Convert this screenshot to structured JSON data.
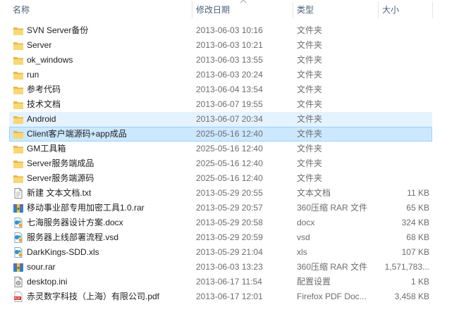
{
  "columns": {
    "name": "名称",
    "date": "修改日期",
    "type": "类型",
    "size": "大小"
  },
  "rows": [
    {
      "name": "SVN Server备份",
      "date": "2013-06-03 10:16",
      "type": "文件夹",
      "size": "",
      "icon": "folder-icon",
      "state": ""
    },
    {
      "name": "Server",
      "date": "2013-06-03 10:21",
      "type": "文件夹",
      "size": "",
      "icon": "folder-icon",
      "state": ""
    },
    {
      "name": "ok_windows",
      "date": "2013-06-03 13:55",
      "type": "文件夹",
      "size": "",
      "icon": "folder-icon",
      "state": ""
    },
    {
      "name": "run",
      "date": "2013-06-03 20:24",
      "type": "文件夹",
      "size": "",
      "icon": "folder-icon",
      "state": ""
    },
    {
      "name": "参考代码",
      "date": "2013-06-04 13:54",
      "type": "文件夹",
      "size": "",
      "icon": "folder-icon",
      "state": ""
    },
    {
      "name": "技术文档",
      "date": "2013-06-07 19:55",
      "type": "文件夹",
      "size": "",
      "icon": "folder-icon",
      "state": ""
    },
    {
      "name": "Android",
      "date": "2013-06-07 20:34",
      "type": "文件夹",
      "size": "",
      "icon": "folder-icon",
      "state": "hover"
    },
    {
      "name": "Client客户端源码+app成品",
      "date": "2025-05-16 12:40",
      "type": "文件夹",
      "size": "",
      "icon": "folder-icon",
      "state": "selected"
    },
    {
      "name": "GM工具箱",
      "date": "2025-05-16 12:40",
      "type": "文件夹",
      "size": "",
      "icon": "folder-icon",
      "state": ""
    },
    {
      "name": "Server服务端成品",
      "date": "2025-05-16 12:40",
      "type": "文件夹",
      "size": "",
      "icon": "folder-icon",
      "state": ""
    },
    {
      "name": "Server服务端源码",
      "date": "2025-05-16 12:40",
      "type": "文件夹",
      "size": "",
      "icon": "folder-icon",
      "state": ""
    },
    {
      "name": "新建 文本文档.txt",
      "date": "2013-05-29 20:55",
      "type": "文本文档",
      "size": "11 KB",
      "icon": "text-file-icon",
      "state": ""
    },
    {
      "name": "移动事业部专用加密工具1.0.rar",
      "date": "2013-05-29 20:57",
      "type": "360压缩 RAR 文件",
      "size": "65 KB",
      "icon": "rar-archive-icon",
      "state": ""
    },
    {
      "name": "七海服务器设计方案.docx",
      "date": "2013-05-29 20:58",
      "type": "docx",
      "size": "324 KB",
      "icon": "document-file-icon",
      "state": ""
    },
    {
      "name": "服务器上线部署流程.vsd",
      "date": "2013-05-29 20:59",
      "type": "vsd",
      "size": "68 KB",
      "icon": "document-file-icon",
      "state": ""
    },
    {
      "name": "DarkKings-SDD.xls",
      "date": "2013-05-29 21:04",
      "type": "xls",
      "size": "107 KB",
      "icon": "document-file-icon",
      "state": ""
    },
    {
      "name": "sour.rar",
      "date": "2013-06-03 13:23",
      "type": "360压缩 RAR 文件",
      "size": "1,571,783...",
      "icon": "rar-archive-icon",
      "state": ""
    },
    {
      "name": "desktop.ini",
      "date": "2013-06-17 11:54",
      "type": "配置设置",
      "size": "1 KB",
      "icon": "settings-file-icon",
      "state": ""
    },
    {
      "name": "赤灵数字科技（上海）有限公司.pdf",
      "date": "2013-06-17 12:01",
      "type": "Firefox PDF Doc...",
      "size": "3,458 KB",
      "icon": "pdf-file-icon",
      "state": ""
    }
  ]
}
